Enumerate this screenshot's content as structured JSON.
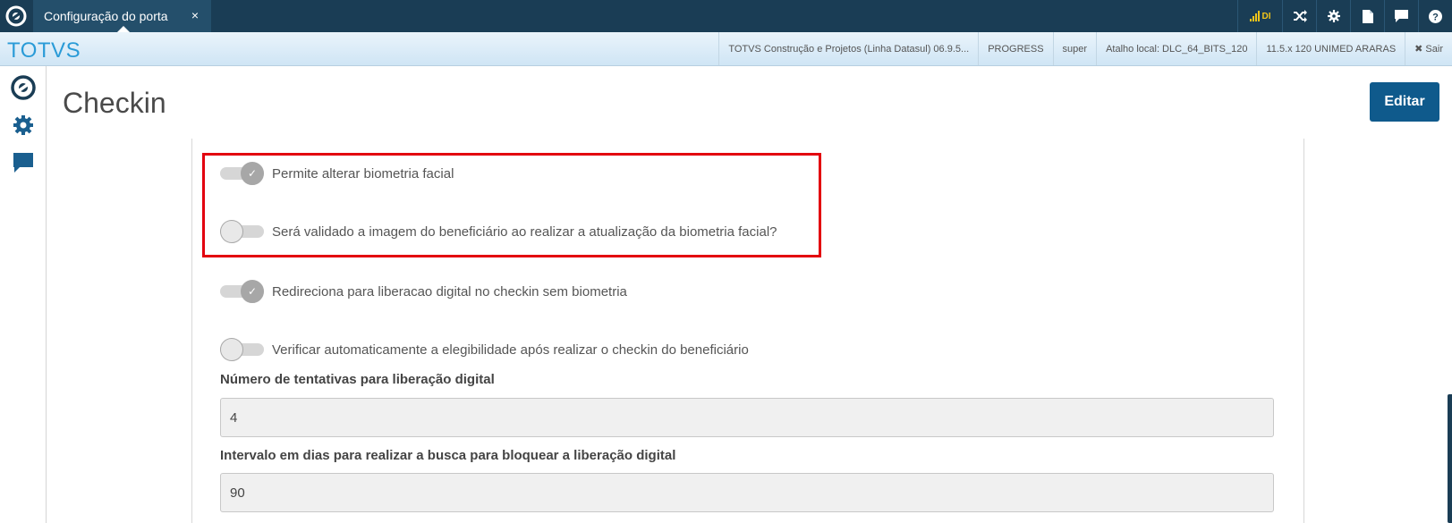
{
  "topbar": {
    "tab_label": "Configuração do porta",
    "tab_close": "×",
    "signal_label": "DI",
    "icons": [
      "shuffle-icon",
      "gear-icon",
      "document-icon",
      "chat-icon",
      "help-icon"
    ]
  },
  "subbar": {
    "brand": "TOTVS",
    "info": [
      "TOTVS Construção e Projetos (Linha Datasul) 06.9.5...",
      "PROGRESS",
      "super",
      "Atalho local: DLC_64_BITS_120",
      "11.5.x 120 UNIMED ARARAS"
    ],
    "exit_label": "✖ Sair"
  },
  "sidebar": {
    "icons": [
      "totvs-logo-icon",
      "gear-icon",
      "chat-icon"
    ]
  },
  "page": {
    "title": "Checkin",
    "edit_label": "Editar"
  },
  "switches": [
    {
      "label": "Permite alterar biometria facial",
      "checked": true
    },
    {
      "label": "Será validado a imagem do beneficiário ao realizar a atualização da biometria facial?",
      "checked": false
    },
    {
      "label": "Redireciona para liberacao digital no checkin sem biometria",
      "checked": true
    },
    {
      "label": "Verificar automaticamente a elegibilidade após realizar o checkin do beneficiário",
      "checked": false
    }
  ],
  "fields": [
    {
      "label": "Número de tentativas para liberação digital",
      "value": "4"
    },
    {
      "label": "Intervalo em dias para realizar a busca para bloquear a liberação digital",
      "value": "90"
    }
  ],
  "colors": {
    "topbar": "#1a3d55",
    "brand": "#2a9bd7",
    "primary_button": "#0f5a8c",
    "highlight": "#e3000f"
  }
}
